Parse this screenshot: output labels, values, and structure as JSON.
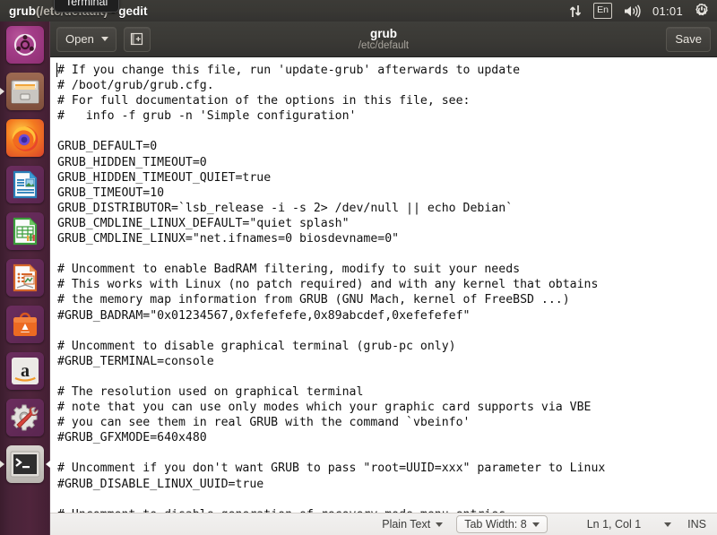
{
  "top_panel": {
    "window_title_app": "grub",
    "window_title_path": "(/etc/default)",
    "window_title_sep": " - ",
    "window_title_program": "gedit",
    "window_title_full": "grub (/etc/default) - gedit",
    "indicators": {
      "network_icon": "network-up-down-arrows-icon",
      "keyboard_layout": "En",
      "volume_icon": "volume-speaker-icon",
      "clock": "01:01",
      "session_icon": "gear-power-icon"
    }
  },
  "tooltip": {
    "label": "Terminal"
  },
  "launcher": {
    "items": [
      {
        "name": "ubuntu-dash",
        "label": "Ubuntu Dash",
        "icon": "ubuntu-logo-icon",
        "running": false,
        "focused": false
      },
      {
        "name": "files",
        "label": "Files",
        "icon": "file-cabinet-icon",
        "running": true,
        "focused": false
      },
      {
        "name": "firefox",
        "label": "Firefox Web Browser",
        "icon": "firefox-icon",
        "running": false,
        "focused": false
      },
      {
        "name": "libreoffice-writer",
        "label": "LibreOffice Writer",
        "icon": "document-writer-icon",
        "running": false,
        "focused": false
      },
      {
        "name": "libreoffice-calc",
        "label": "LibreOffice Calc",
        "icon": "spreadsheet-calc-icon",
        "running": false,
        "focused": false
      },
      {
        "name": "libreoffice-impress",
        "label": "LibreOffice Impress",
        "icon": "presentation-impress-icon",
        "running": false,
        "focused": false
      },
      {
        "name": "ubuntu-software",
        "label": "Ubuntu Software",
        "icon": "software-bag-icon",
        "running": false,
        "focused": false
      },
      {
        "name": "amazon",
        "label": "Amazon",
        "icon": "amazon-icon",
        "running": false,
        "focused": false
      },
      {
        "name": "system-settings",
        "label": "System Settings",
        "icon": "gear-wrench-icon",
        "running": false,
        "focused": false
      },
      {
        "name": "terminal",
        "label": "Terminal",
        "icon": "terminal-prompt-icon",
        "running": true,
        "focused": true
      }
    ]
  },
  "gedit": {
    "headerbar": {
      "open_label": "Open",
      "open_caret_icon": "chevron-down-icon",
      "new_document_icon": "new-document-icon",
      "title": "grub",
      "subtitle": "/etc/default",
      "save_label": "Save"
    },
    "document": {
      "text": "# If you change this file, run 'update-grub' afterwards to update\n# /boot/grub/grub.cfg.\n# For full documentation of the options in this file, see:\n#   info -f grub -n 'Simple configuration'\n\nGRUB_DEFAULT=0\nGRUB_HIDDEN_TIMEOUT=0\nGRUB_HIDDEN_TIMEOUT_QUIET=true\nGRUB_TIMEOUT=10\nGRUB_DISTRIBUTOR=`lsb_release -i -s 2> /dev/null || echo Debian`\nGRUB_CMDLINE_LINUX_DEFAULT=\"quiet splash\"\nGRUB_CMDLINE_LINUX=\"net.ifnames=0 biosdevname=0\"\n\n# Uncomment to enable BadRAM filtering, modify to suit your needs\n# This works with Linux (no patch required) and with any kernel that obtains\n# the memory map information from GRUB (GNU Mach, kernel of FreeBSD ...)\n#GRUB_BADRAM=\"0x01234567,0xfefefefe,0x89abcdef,0xefefefef\"\n\n# Uncomment to disable graphical terminal (grub-pc only)\n#GRUB_TERMINAL=console\n\n# The resolution used on graphical terminal\n# note that you can use only modes which your graphic card supports via VBE\n# you can see them in real GRUB with the command `vbeinfo'\n#GRUB_GFXMODE=640x480\n\n# Uncomment if you don't want GRUB to pass \"root=UUID=xxx\" parameter to Linux\n#GRUB_DISABLE_LINUX_UUID=true\n\n# Uncomment to disable generation of recovery mode menu entries"
    },
    "statusbar": {
      "language": "Plain Text",
      "language_caret_icon": "chevron-down-icon",
      "tab_width": "Tab Width: 8",
      "tab_width_caret_icon": "chevron-down-icon",
      "cursor_position": "Ln 1, Col 1",
      "cursor_caret_icon": "chevron-down-icon",
      "insert_mode": "INS"
    }
  },
  "colors": {
    "launcher_bg": "#4b2239",
    "panel_bg": "#3a3935",
    "headerbar_bg": "#3a3935",
    "editor_bg": "#ffffff",
    "statusbar_bg": "#efedeb",
    "text": "#111111",
    "accent_orange": "#e8722a"
  }
}
